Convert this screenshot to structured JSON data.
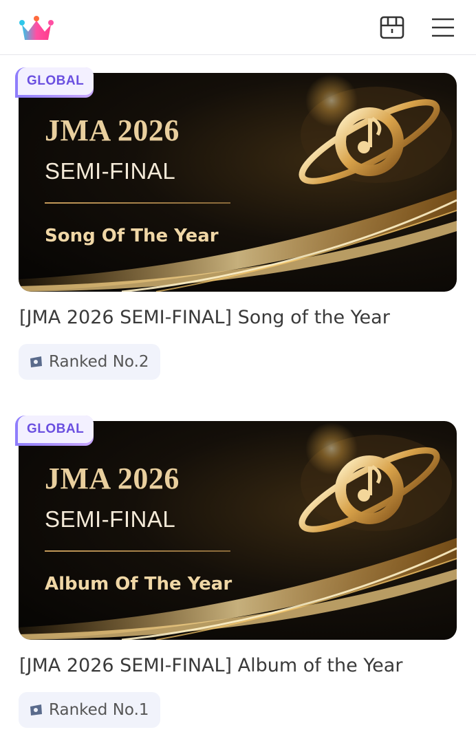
{
  "header": {
    "logo_icon": "crown-logo-icon",
    "vote_icon": "ballot-box-icon",
    "menu_icon": "hamburger-menu-icon",
    "logo_colors": [
      "#ff4fa3",
      "#36c6e8",
      "#ff6b3d",
      "#a66bff"
    ]
  },
  "cards": [
    {
      "badge": "GLOBAL",
      "banner_title": "JMA 2026",
      "banner_subtitle": "SEMI-FINAL",
      "banner_category": "Song Of The Year",
      "title": "[JMA 2026 SEMI-FINAL] Song of the Year",
      "rank": "Ranked No.2"
    },
    {
      "badge": "GLOBAL",
      "banner_title": "JMA 2026",
      "banner_subtitle": "SEMI-FINAL",
      "banner_category": "Album Of The Year",
      "title": "[JMA 2026 SEMI-FINAL] Album of the Year",
      "rank": "Ranked No.1"
    }
  ],
  "colors": {
    "badge_accent": "#6a4fe0",
    "banner_gold": "#e9cf9e",
    "chip_bg": "#f1f3fb"
  }
}
